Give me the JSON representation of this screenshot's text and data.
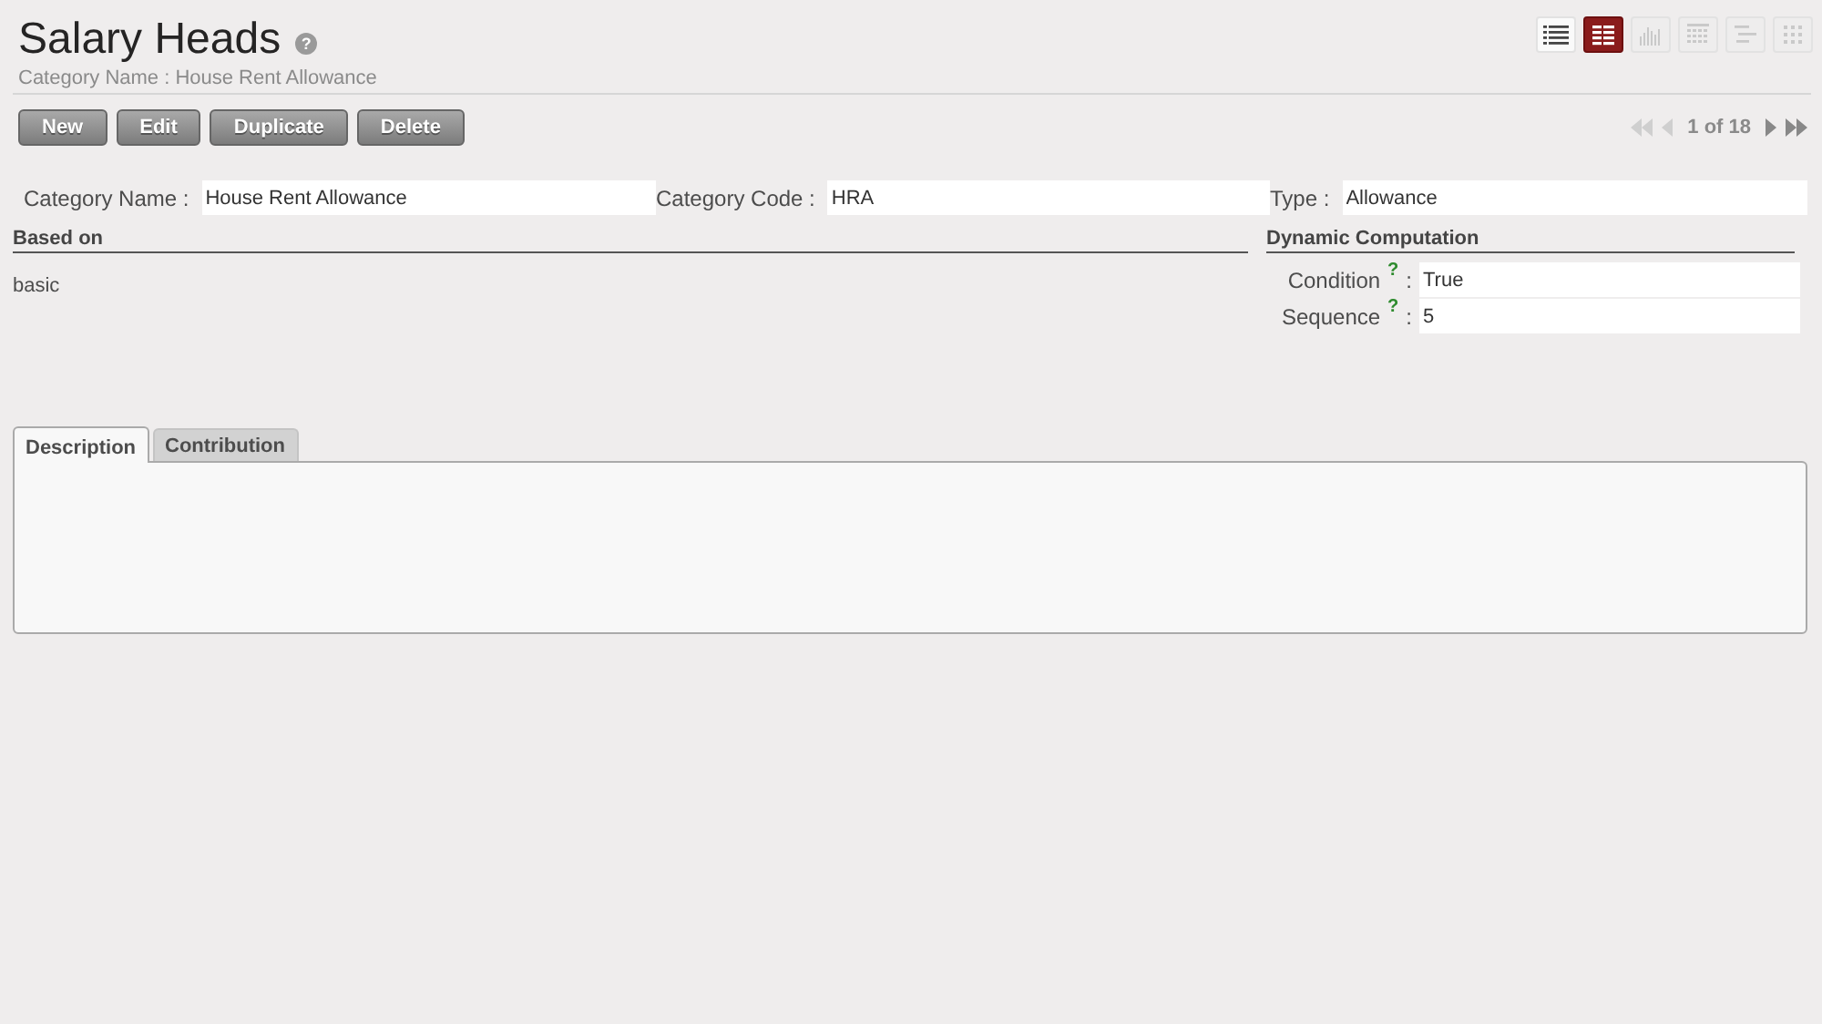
{
  "header": {
    "title": "Salary Heads",
    "help": "?",
    "subtitle": "Category Name : House Rent Allowance"
  },
  "view_switcher": [
    {
      "kind": "list",
      "selected": false
    },
    {
      "kind": "form",
      "selected": true
    },
    {
      "kind": "graph",
      "selected": false
    },
    {
      "kind": "calendar",
      "selected": false
    },
    {
      "kind": "gantt",
      "selected": false
    },
    {
      "kind": "kanban",
      "selected": false
    }
  ],
  "actions": [
    "New",
    "Edit",
    "Duplicate",
    "Delete"
  ],
  "pager": {
    "first_disabled": true,
    "prev_disabled": true,
    "text": "1 of 18",
    "next_disabled": false,
    "last_disabled": false
  },
  "top_fields": [
    {
      "label": "Category Name :",
      "value": "House Rent Allowance"
    },
    {
      "label": "Category Code :",
      "value": "HRA"
    },
    {
      "label": "Type :",
      "value": "Allowance"
    }
  ],
  "based_on": {
    "title": "Based on",
    "value": "basic"
  },
  "dynamic": {
    "title": "Dynamic Computation",
    "fields": [
      {
        "label": "Condition",
        "help": "?",
        "sep": ":",
        "value": "True"
      },
      {
        "label": "Sequence",
        "help": "?",
        "sep": ":",
        "value": "5"
      }
    ]
  },
  "tabs": [
    {
      "label": "Description",
      "selected": true
    },
    {
      "label": "Contribution",
      "selected": false
    }
  ]
}
